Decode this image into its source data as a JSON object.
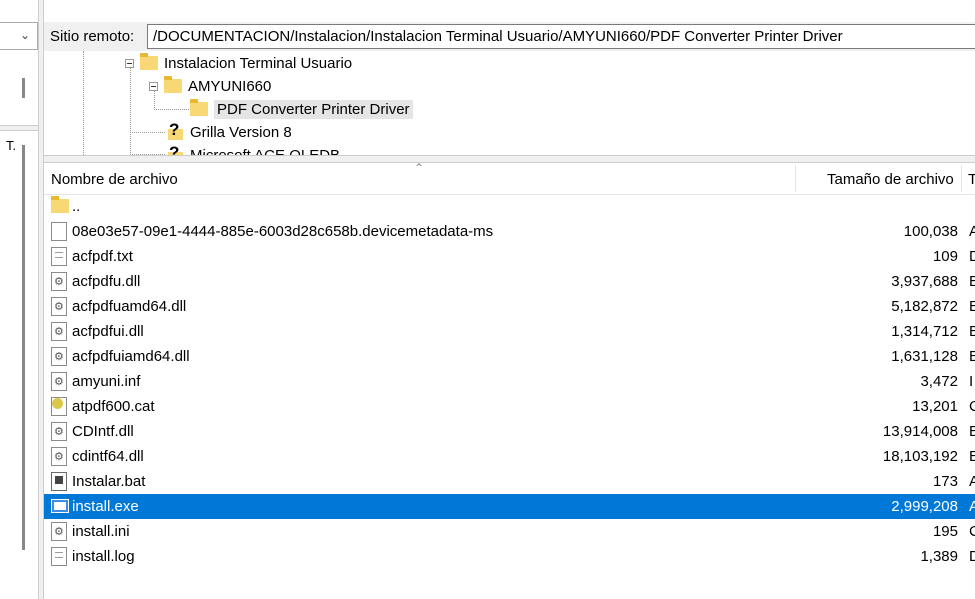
{
  "remote_site": {
    "label": "Sitio remoto:",
    "path": "/DOCUMENTACION/Instalacion/Instalacion Terminal Usuario/AMYUNI660/PDF Converter Printer Driver"
  },
  "left_pane": {
    "clipped_label": "T."
  },
  "tree": [
    {
      "label": "Instalacion Terminal Usuario",
      "icon": "folder-icon"
    },
    {
      "label": "AMYUNI660",
      "icon": "folder-icon"
    },
    {
      "label": "PDF Converter Printer Driver",
      "icon": "folder-icon",
      "selected": true
    },
    {
      "label": "Grilla Version 8",
      "icon": "unknown-folder-icon"
    },
    {
      "label": "Microsoft ACE OLEDB",
      "icon": "unknown-folder-icon"
    }
  ],
  "list_headers": {
    "name": "Nombre de archivo",
    "size": "Tamaño de archivo",
    "type": "T"
  },
  "files": [
    {
      "name": "..",
      "size": "",
      "type": "",
      "icon": "folder-up-icon"
    },
    {
      "name": "08e03e57-09e1-4444-885e-6003d28c658b.devicemetadata-ms",
      "size": "100,038",
      "type": "A",
      "icon": "blank-file-icon"
    },
    {
      "name": "acfpdf.txt",
      "size": "109",
      "type": "D",
      "icon": "text-file-icon"
    },
    {
      "name": "acfpdfu.dll",
      "size": "3,937,688",
      "type": "E",
      "icon": "dll-file-icon"
    },
    {
      "name": "acfpdfuamd64.dll",
      "size": "5,182,872",
      "type": "E",
      "icon": "dll-file-icon"
    },
    {
      "name": "acfpdfui.dll",
      "size": "1,314,712",
      "type": "E",
      "icon": "dll-file-icon"
    },
    {
      "name": "acfpdfuiamd64.dll",
      "size": "1,631,128",
      "type": "E",
      "icon": "dll-file-icon"
    },
    {
      "name": "amyuni.inf",
      "size": "3,472",
      "type": "I",
      "icon": "setup-info-icon"
    },
    {
      "name": "atpdf600.cat",
      "size": "13,201",
      "type": "C",
      "icon": "catalog-file-icon"
    },
    {
      "name": "CDIntf.dll",
      "size": "13,914,008",
      "type": "E",
      "icon": "dll-file-icon"
    },
    {
      "name": "cdintf64.dll",
      "size": "18,103,192",
      "type": "E",
      "icon": "dll-file-icon"
    },
    {
      "name": "Instalar.bat",
      "size": "173",
      "type": "A",
      "icon": "batch-file-icon"
    },
    {
      "name": "install.exe",
      "size": "2,999,208",
      "type": "A",
      "icon": "exe-file-icon",
      "selected": true
    },
    {
      "name": "install.ini",
      "size": "195",
      "type": "C",
      "icon": "settings-file-icon"
    },
    {
      "name": "install.log",
      "size": "1,389",
      "type": "D",
      "icon": "text-file-icon"
    }
  ]
}
